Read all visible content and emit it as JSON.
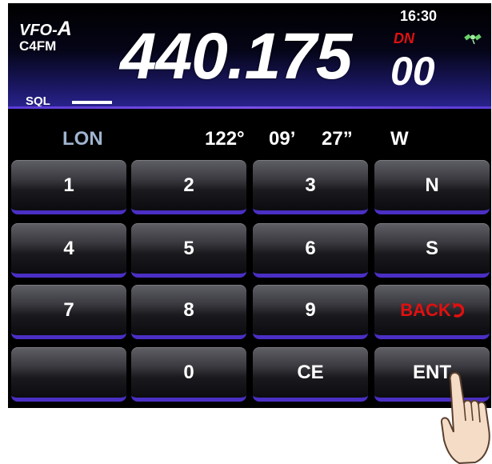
{
  "header": {
    "vfo_prefix": "VFO-",
    "vfo_letter": "A",
    "mode": "C4FM",
    "frequency_main": "440.175",
    "frequency_small": "00",
    "time": "16:30",
    "dn_badge": "DN",
    "sql_label": "SQL",
    "icons": {
      "satellite": "gps-satellite-icon"
    }
  },
  "coordinate": {
    "label": "LON",
    "degrees": "122°",
    "minutes": "09’",
    "seconds": "27”",
    "hemisphere": "W"
  },
  "keypad": {
    "keys": [
      {
        "label": "1"
      },
      {
        "label": "2"
      },
      {
        "label": "3"
      },
      {
        "label": "N"
      },
      {
        "label": "4"
      },
      {
        "label": "5"
      },
      {
        "label": "6"
      },
      {
        "label": "S"
      },
      {
        "label": "7"
      },
      {
        "label": "8"
      },
      {
        "label": "9"
      },
      {
        "label": "BACK"
      },
      {
        "label": ""
      },
      {
        "label": "0"
      },
      {
        "label": "CE"
      },
      {
        "label": "ENT"
      }
    ],
    "icons": {
      "back_arrow": "back-arrow-icon",
      "pointer": "hand-pointer-icon"
    }
  },
  "colors": {
    "background": "#000000",
    "accent_purple": "#4b2fc4",
    "lon_label": "#9fb4d0",
    "alert_red": "#e01010"
  }
}
